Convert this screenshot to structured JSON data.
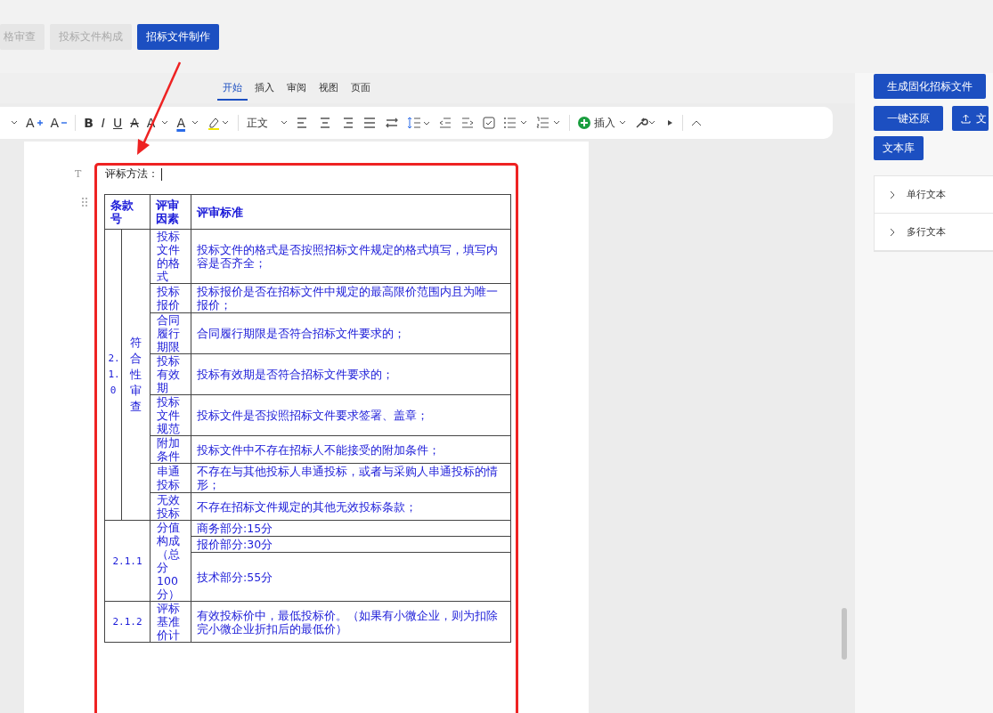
{
  "top_tabs": [
    {
      "label": "格审查",
      "selected": false
    },
    {
      "label": "投标文件构成",
      "selected": false
    },
    {
      "label": "招标文件制作",
      "selected": true
    }
  ],
  "ribbon_tabs": [
    {
      "label": "开始",
      "selected": true
    },
    {
      "label": "插入",
      "selected": false
    },
    {
      "label": "审阅",
      "selected": false
    },
    {
      "label": "视图",
      "selected": false
    },
    {
      "label": "页面",
      "selected": false
    }
  ],
  "toolbar": {
    "grow_font": "A",
    "shrink_font": "A",
    "bold": "B",
    "italic": "I",
    "underline": "U",
    "strike": "A",
    "effect": "A",
    "font_color": "A",
    "style": "正文",
    "insert": "插入"
  },
  "document": {
    "paragraph_marker": "T",
    "paragraph": "评标方法：",
    "table": {
      "header": [
        "条款号",
        "评审因素",
        "评审标准"
      ],
      "groups": [
        {
          "number": "2.1.0",
          "category": "符合性审查",
          "items": [
            {
              "factor": "投标文件的格式",
              "criteria": [
                "投标文件的格式是否按照招标文件规定的格式填写，填写内容是否齐全；"
              ]
            },
            {
              "factor": "投标报价",
              "criteria": [
                "投标报价是否在招标文件中规定的最高限价范围内且为唯一报价；"
              ]
            },
            {
              "factor": "合同履行期限",
              "criteria": [
                "合同履行期限是否符合招标文件要求的；"
              ]
            },
            {
              "factor": "投标有效期",
              "criteria": [
                "投标有效期是否符合招标文件要求的；"
              ]
            },
            {
              "factor": "投标文件规范",
              "criteria": [
                "投标文件是否按照招标文件要求签署、盖章；"
              ]
            },
            {
              "factor": "附加条件",
              "criteria": [
                "投标文件中不存在招标人不能接受的附加条件；"
              ]
            },
            {
              "factor": "串通投标",
              "criteria": [
                "不存在与其他投标人串通投标，或者与采购人串通投标的情形；"
              ]
            },
            {
              "factor": "无效投标",
              "criteria": [
                "不存在招标文件规定的其他无效投标条款；"
              ]
            }
          ]
        },
        {
          "number": "2.1.1",
          "items": [
            {
              "factor": "分值构成（总分100分）",
              "criteria": [
                "商务部分:15分",
                "报价部分:30分",
                "技术部分:55分"
              ]
            }
          ]
        },
        {
          "number": "2.1.2",
          "items": [
            {
              "factor": "评标基准价计",
              "criteria": [
                "有效投标价中，最低投标价。（如果有小微企业，则为扣除完小微企业折扣后的最低价）"
              ]
            }
          ]
        }
      ]
    }
  },
  "side": {
    "buttons": [
      "生成固化招标文件",
      "一键还原",
      "文",
      "文本库"
    ],
    "sections": [
      {
        "label": "单行文本",
        "expanded": false
      },
      {
        "label": "多行文本",
        "expanded": false
      }
    ]
  }
}
